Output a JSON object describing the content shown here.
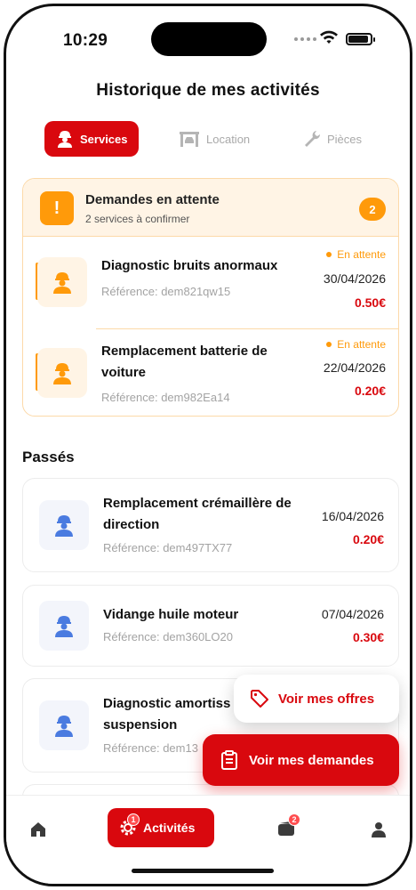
{
  "status": {
    "time": "10:29"
  },
  "header": {
    "title": "Historique de mes activités"
  },
  "tabs": [
    {
      "label": "Services",
      "icon": "mechanic-icon",
      "active": true
    },
    {
      "label": "Location",
      "icon": "car-lift-icon",
      "active": false
    },
    {
      "label": "Pièces",
      "icon": "wrench-icon",
      "active": false
    }
  ],
  "pending": {
    "title": "Demandes en attente",
    "subtitle": "2 services à confirmer",
    "count": "2",
    "items": [
      {
        "name": "Diagnostic bruits anormaux",
        "reference": "Référence: dem821qw15",
        "status": "En attente",
        "date": "30/04/2026",
        "price": "0.50€"
      },
      {
        "name": "Remplacement batterie de voiture",
        "reference": "Référence: dem982Ea14",
        "status": "En attente",
        "date": "22/04/2026",
        "price": "0.20€"
      }
    ]
  },
  "past": {
    "title": "Passés",
    "items": [
      {
        "name": "Remplacement crémaillère de direction",
        "reference": "Référence: dem497TX77",
        "date": "16/04/2026",
        "price": "0.20€"
      },
      {
        "name": "Vidange huile moteur",
        "reference": "Référence: dem360LO20",
        "date": "07/04/2026",
        "price": "0.30€"
      },
      {
        "name": "Diagnostic amortiss suspension",
        "reference": "Référence: dem13",
        "date": "",
        "price": ""
      }
    ]
  },
  "fab": {
    "offers_label": "Voir mes offres",
    "requests_label": "Voir mes demandes"
  },
  "nav": {
    "active_label": "Activités",
    "activities_badge": "1",
    "wallet_badge": "2"
  },
  "colors": {
    "brand_red": "#d9080e",
    "pending_orange": "#ff9a0a",
    "pending_bg": "#fff4e5"
  }
}
